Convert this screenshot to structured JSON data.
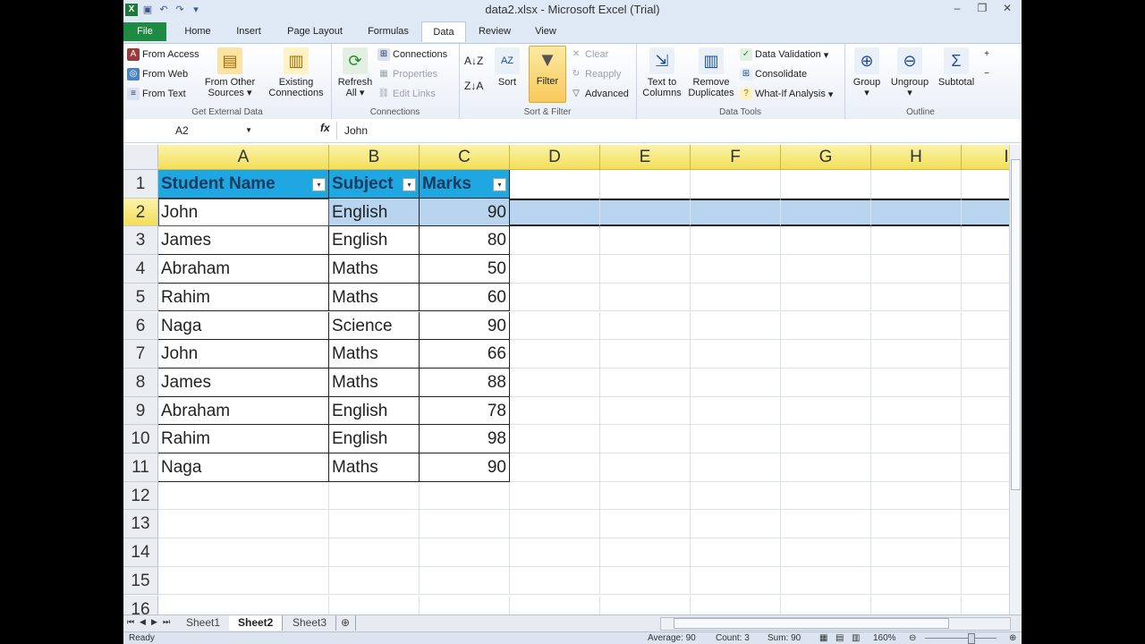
{
  "window": {
    "title": "data2.xlsx  -  Microsoft Excel (Trial)",
    "controls": [
      "–",
      "❐",
      "✕"
    ]
  },
  "tabs": [
    "File",
    "Home",
    "Insert",
    "Page Layout",
    "Formulas",
    "Data",
    "Review",
    "View"
  ],
  "active_tab": "Data",
  "ribbon": {
    "get_external_data": {
      "label": "Get External Data",
      "from_access": "From Access",
      "from_web": "From Web",
      "from_text": "From Text",
      "from_other_1": "From Other",
      "from_other_2": "Sources",
      "existing_1": "Existing",
      "existing_2": "Connections"
    },
    "connections": {
      "label": "Connections",
      "refresh_1": "Refresh",
      "refresh_2": "All",
      "connections": "Connections",
      "properties": "Properties",
      "edit_links": "Edit Links"
    },
    "sort_filter": {
      "label": "Sort & Filter",
      "sort": "Sort",
      "filter": "Filter",
      "clear": "Clear",
      "reapply": "Reapply",
      "advanced": "Advanced"
    },
    "data_tools": {
      "label": "Data Tools",
      "text_to_1": "Text to",
      "text_to_2": "Columns",
      "remove_1": "Remove",
      "remove_2": "Duplicates",
      "data_validation": "Data Validation",
      "consolidate": "Consolidate",
      "what_if": "What-If Analysis"
    },
    "outline": {
      "label": "Outline",
      "group": "Group",
      "ungroup": "Ungroup",
      "subtotal": "Subtotal"
    }
  },
  "formula_bar": {
    "name_box": "A2",
    "fx": "fx",
    "content": "John"
  },
  "grid": {
    "columns": [
      "A",
      "B",
      "C",
      "D",
      "E",
      "F",
      "G",
      "H",
      "I"
    ],
    "row_numbers": [
      "1",
      "2",
      "3",
      "4",
      "5",
      "6",
      "7",
      "8",
      "9",
      "10",
      "11",
      "12",
      "13",
      "14",
      "15",
      "16"
    ],
    "headers": [
      "Student Name",
      "Subject",
      "Marks"
    ],
    "rows": [
      [
        "John",
        "English",
        "90"
      ],
      [
        "James",
        "English",
        "80"
      ],
      [
        "Abraham",
        "Maths",
        "50"
      ],
      [
        "Rahim",
        "Maths",
        "60"
      ],
      [
        "Naga",
        "Science",
        "90"
      ],
      [
        "John",
        "Maths",
        "66"
      ],
      [
        "James",
        "Maths",
        "88"
      ],
      [
        "Abraham",
        "English",
        "78"
      ],
      [
        "Rahim",
        "English",
        "98"
      ],
      [
        "Naga",
        "Maths",
        "90"
      ]
    ]
  },
  "sheets": [
    "Sheet1",
    "Sheet2",
    "Sheet3"
  ],
  "active_sheet": "Sheet2",
  "status": {
    "mode": "Ready",
    "average": "Average: 90",
    "count": "Count: 3",
    "sum": "Sum: 90",
    "zoom": "160%"
  },
  "colors": {
    "header_fill": "#1ea7e1",
    "selection": "#b9d4ee",
    "file_tab": "#1f8a43"
  }
}
